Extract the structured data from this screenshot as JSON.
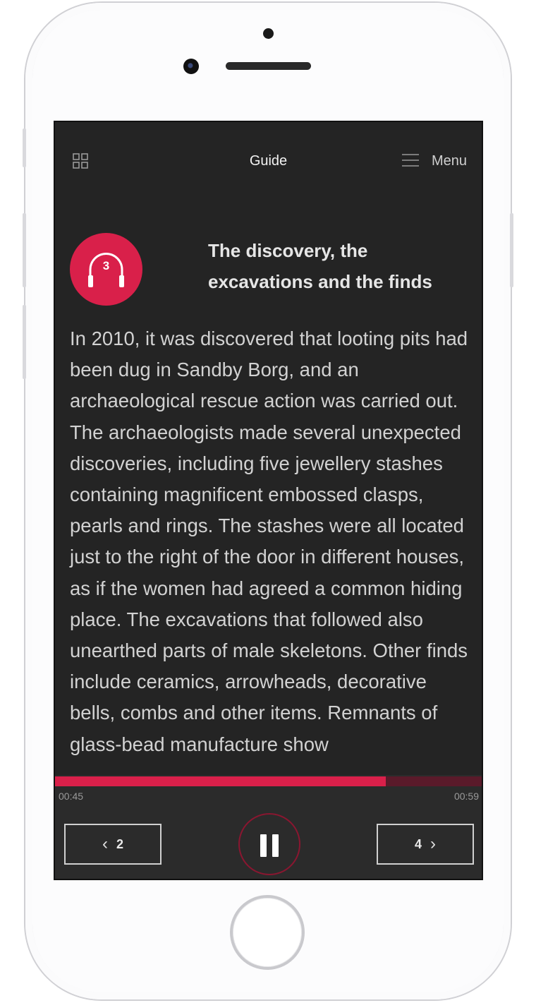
{
  "header": {
    "title": "Guide",
    "menu_label": "Menu"
  },
  "track": {
    "number": "3",
    "title": "The discovery, the excavations and the finds",
    "body": "In 2010, it was discovered that looting pits had been dug in Sandby Borg, and an archaeological rescue action was carried out. The archaeologists made several unexpected discoveries, including five jewellery stashes containing magnificent embossed clasps, pearls and rings. The stashes were all located just to the right of the door in different houses, as if the women had agreed a common hiding place. The excavations that followed also unearthed parts of male skeletons. Other finds include ceramics, arrowheads, decorative bells, combs and other items. Remnants of glass-bead manufacture show"
  },
  "player": {
    "current_time": "00:45",
    "duration": "00:59",
    "progress_fraction": 0.775,
    "prev_label": "2",
    "next_label": "4"
  },
  "colors": {
    "accent": "#d9204a",
    "screen_bg": "#242424",
    "player_bg": "#2b2b2b"
  }
}
